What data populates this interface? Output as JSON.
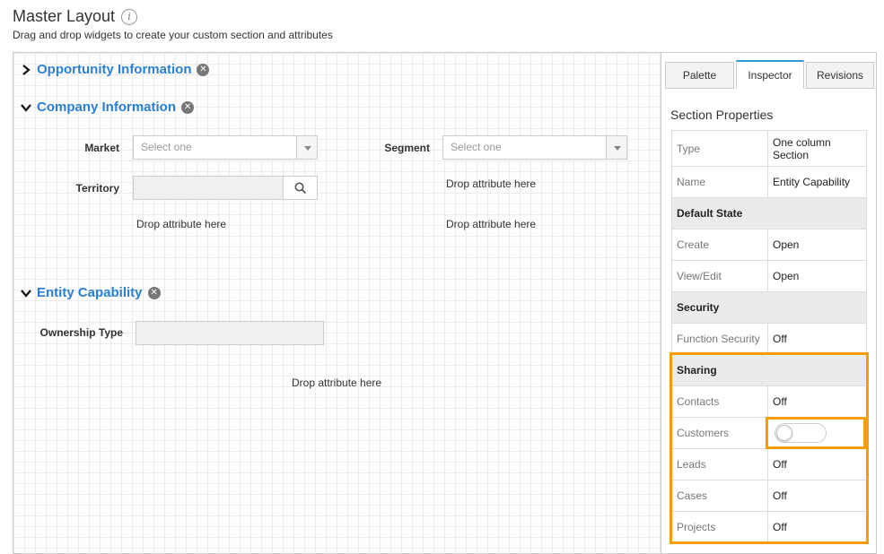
{
  "header": {
    "title": "Master Layout",
    "subtitle": "Drag and drop widgets to create your custom section and attributes"
  },
  "sections": {
    "opportunity": {
      "title": "Opportunity Information"
    },
    "company": {
      "title": "Company Information",
      "market_label": "Market",
      "market_placeholder": "Select one",
      "segment_label": "Segment",
      "segment_placeholder": "Select one",
      "territory_label": "Territory",
      "drop_1": "Drop attribute here",
      "drop_2": "Drop attribute here",
      "drop_3": "Drop attribute here"
    },
    "entity": {
      "title": "Entity Capability",
      "ownership_label": "Ownership Type",
      "drop": "Drop attribute here"
    }
  },
  "panel": {
    "tabs": [
      "Palette",
      "Inspector",
      "Revisions"
    ],
    "active_tab": "Inspector",
    "heading": "Section Properties",
    "rows": {
      "type_k": "Type",
      "type_v": "One column Section",
      "name_k": "Name",
      "name_v": "Entity Capability",
      "default_state": "Default State",
      "create_k": "Create",
      "create_v": "Open",
      "view_k": "View/Edit",
      "view_v": "Open",
      "security": "Security",
      "func_k": "Function Security",
      "func_v": "Off",
      "sharing": "Sharing",
      "contacts_k": "Contacts",
      "contacts_v": "Off",
      "customers_k": "Customers",
      "leads_k": "Leads",
      "leads_v": "Off",
      "cases_k": "Cases",
      "cases_v": "Off",
      "projects_k": "Projects",
      "projects_v": "Off"
    }
  },
  "colors": {
    "link_blue": "#2b7fd1",
    "highlight_orange": "#f59d0b",
    "active_tab_blue": "#2b9cd8"
  }
}
